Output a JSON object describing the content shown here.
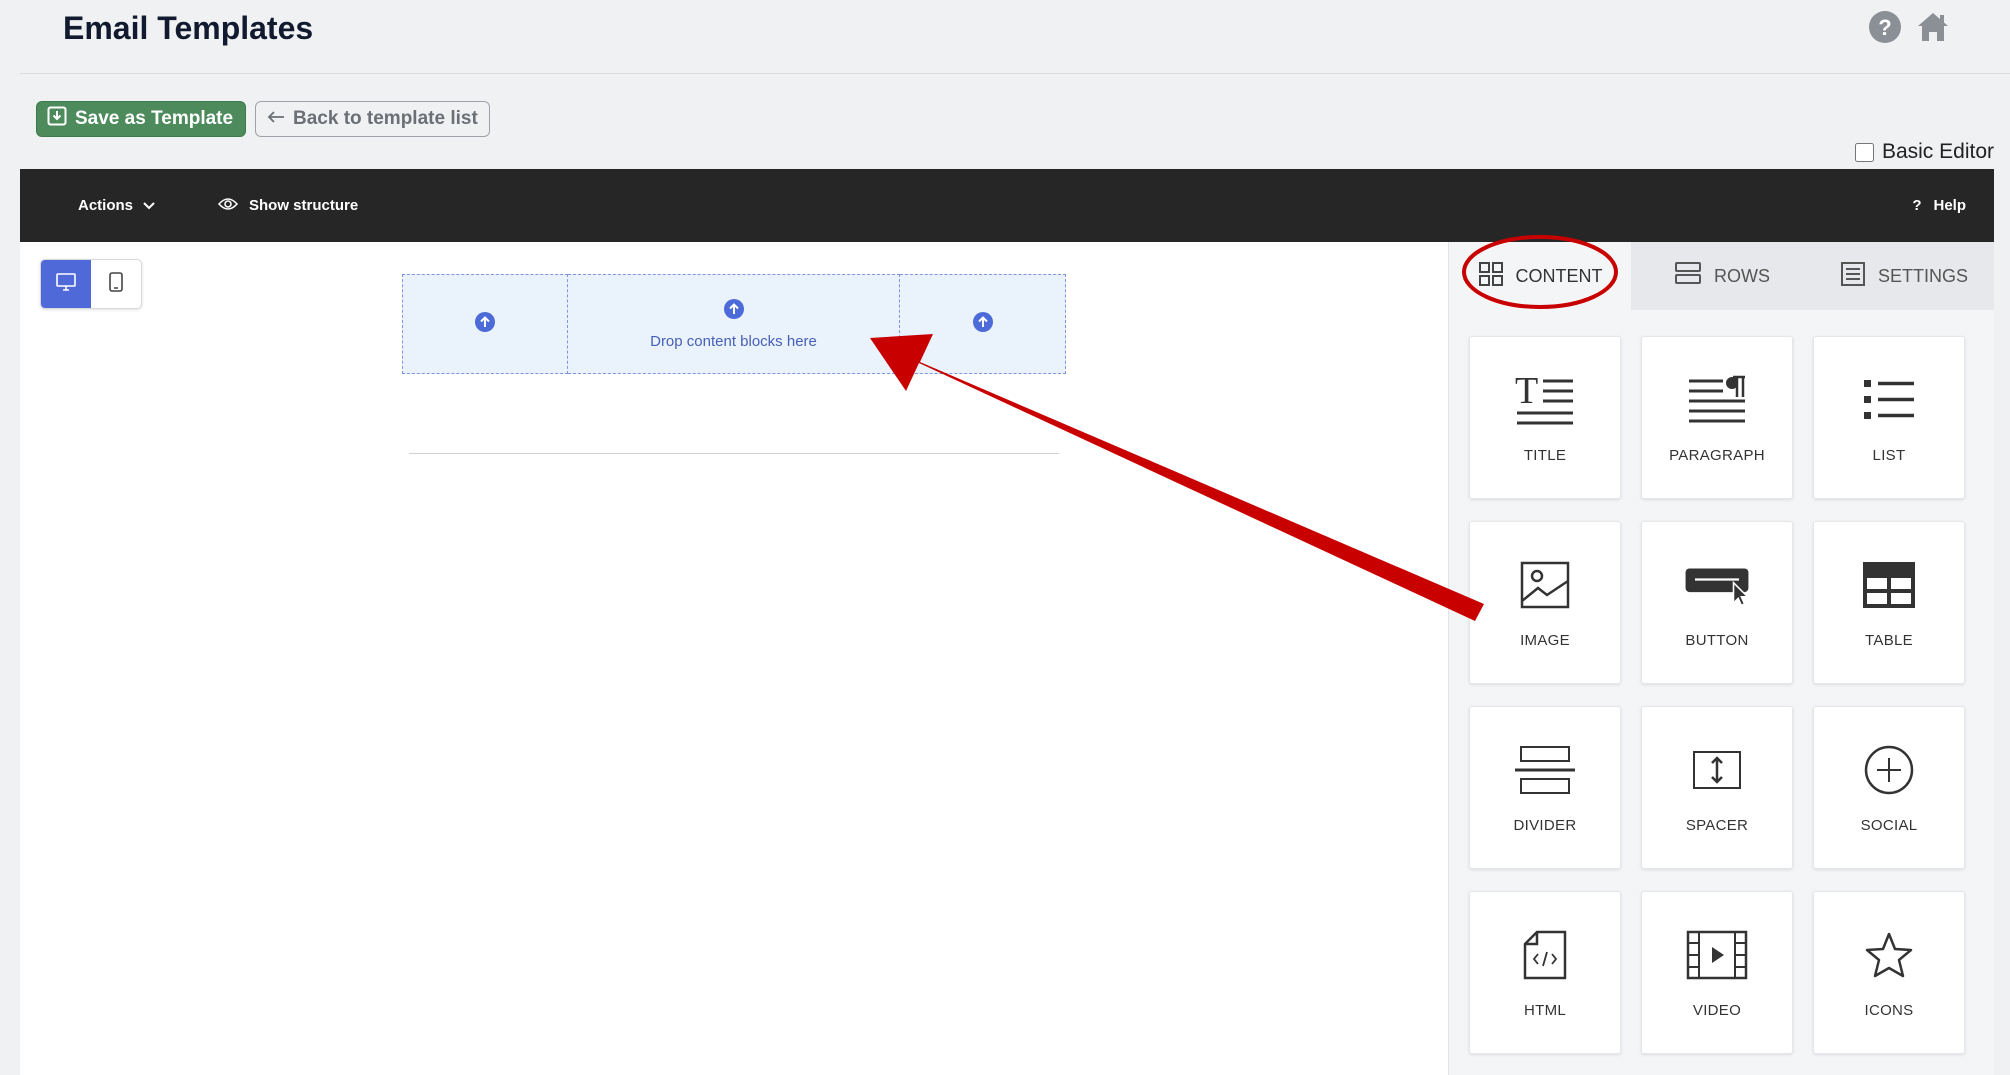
{
  "header": {
    "title": "Email Templates",
    "help_icon": "help-circle-icon",
    "home_icon": "home-icon"
  },
  "actions": {
    "save_label": "Save as Template",
    "back_label": "Back to template list",
    "basic_editor_label": "Basic Editor",
    "basic_editor_checked": false
  },
  "toolbar": {
    "actions_label": "Actions",
    "show_structure_label": "Show structure",
    "help_label": "Help"
  },
  "canvas": {
    "drop_text": "Drop content blocks here",
    "device_modes": [
      "desktop",
      "mobile"
    ],
    "active_device": "desktop"
  },
  "sidebar": {
    "tabs": [
      {
        "label": "CONTENT",
        "icon": "grid-icon"
      },
      {
        "label": "ROWS",
        "icon": "rows-icon"
      },
      {
        "label": "SETTINGS",
        "icon": "settings-list-icon"
      }
    ],
    "active_tab": "CONTENT",
    "blocks": [
      {
        "label": "TITLE",
        "icon": "title-icon"
      },
      {
        "label": "PARAGRAPH",
        "icon": "paragraph-icon"
      },
      {
        "label": "LIST",
        "icon": "list-icon"
      },
      {
        "label": "IMAGE",
        "icon": "image-icon"
      },
      {
        "label": "BUTTON",
        "icon": "button-icon"
      },
      {
        "label": "TABLE",
        "icon": "table-icon"
      },
      {
        "label": "DIVIDER",
        "icon": "divider-icon"
      },
      {
        "label": "SPACER",
        "icon": "spacer-icon"
      },
      {
        "label": "SOCIAL",
        "icon": "social-icon"
      },
      {
        "label": "HTML",
        "icon": "html-icon"
      },
      {
        "label": "VIDEO",
        "icon": "video-icon"
      },
      {
        "label": "ICONS",
        "icon": "star-icon"
      }
    ]
  },
  "colors": {
    "save_button": "#4d8b5d",
    "toolbar": "#262626",
    "active_device": "#5069d8",
    "drop_zone": "#eaf2fc",
    "drop_text": "#4660b9",
    "annotation": "#c80000"
  }
}
